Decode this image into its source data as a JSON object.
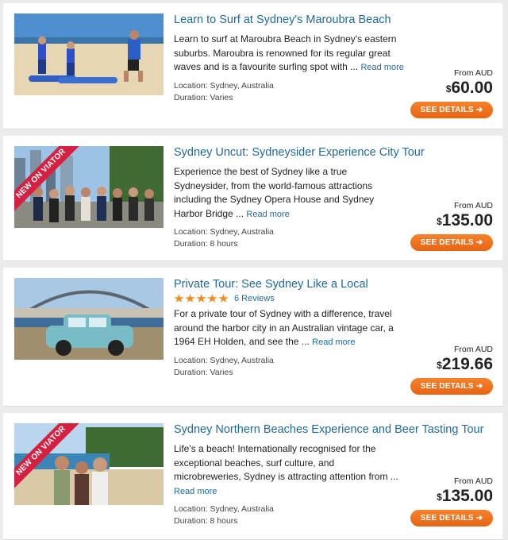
{
  "tours": [
    {
      "title": "Learn to Surf at Sydney's Maroubra Beach",
      "description": "Learn to surf at Maroubra Beach in Sydney's eastern suburbs. Maroubra is renowned for its regular great waves and is a favourite surfing spot with ...",
      "read_more": "Read more",
      "location": "Location: Sydney, Australia",
      "duration": "Duration: Varies",
      "from_label": "From AUD",
      "currency": "$",
      "price": "60.00",
      "button": "SEE DETAILS ➔"
    },
    {
      "badge": "NEW ON VIATOR",
      "title": "Sydney Uncut: Sydneysider Experience City Tour",
      "description": "Experience the best of Sydney like a true Sydneysider, from the world-famous attractions including the Sydney Opera House and Sydney Harbor Bridge ...",
      "read_more": "Read more",
      "location": "Location: Sydney, Australia",
      "duration": "Duration: 8 hours",
      "from_label": "From AUD",
      "currency": "$",
      "price": "135.00",
      "button": "SEE DETAILS ➔"
    },
    {
      "title": "Private Tour: See Sydney Like a Local",
      "rating": 5,
      "reviews": "6 Reviews",
      "description": "For a private tour of Sydney with a difference, travel around the harbor city in an Australian vintage car, a 1964 EH Holden, and see the ...",
      "read_more": "Read more",
      "location": "Location: Sydney, Australia",
      "duration": "Duration: Varies",
      "from_label": "From AUD",
      "currency": "$",
      "price": "219.66",
      "button": "SEE DETAILS ➔"
    },
    {
      "badge": "NEW ON VIATOR",
      "title": "Sydney Northern Beaches Experience and Beer Tasting Tour",
      "description": "Life's a beach! Internationally recognised for the exceptional beaches, surf culture, and microbreweries, Sydney is attracting attention from ...",
      "read_more": "Read more",
      "location": "Location: Sydney, Australia",
      "duration": "Duration: 8 hours",
      "from_label": "From AUD",
      "currency": "$",
      "price": "135.00",
      "button": "SEE DETAILS ➔"
    }
  ],
  "colors": {
    "link": "#1f6a9c",
    "button": "#ef7120",
    "badge": "#d62041",
    "star": "#f28a1d"
  }
}
